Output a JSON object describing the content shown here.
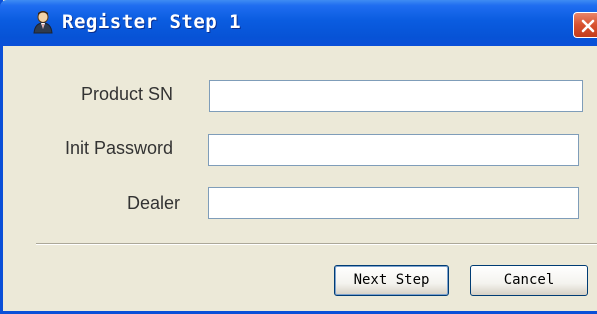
{
  "window": {
    "title": "Register Step 1",
    "title_icon": "user-icon",
    "close_icon": "close-icon",
    "accent_color": "#0a5ce0",
    "close_color": "#d8512f"
  },
  "form": {
    "fields": [
      {
        "label": "Product SN",
        "value": "",
        "placeholder": ""
      },
      {
        "label": "Init Password",
        "value": "",
        "placeholder": ""
      },
      {
        "label": "Dealer",
        "value": "",
        "placeholder": ""
      }
    ]
  },
  "buttons": {
    "next_label": "Next Step",
    "cancel_label": "Cancel"
  }
}
